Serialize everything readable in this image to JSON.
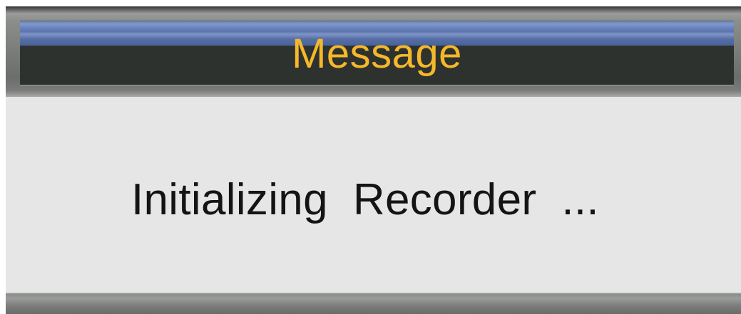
{
  "dialog": {
    "title": "Message",
    "message": "Initializing  Recorder  ..."
  },
  "colors": {
    "title_text": "#f5b82a",
    "title_bar": "#2e322f",
    "title_stripe": "#6e88c0",
    "body_background": "#e6e6e6",
    "message_text": "#141414"
  }
}
